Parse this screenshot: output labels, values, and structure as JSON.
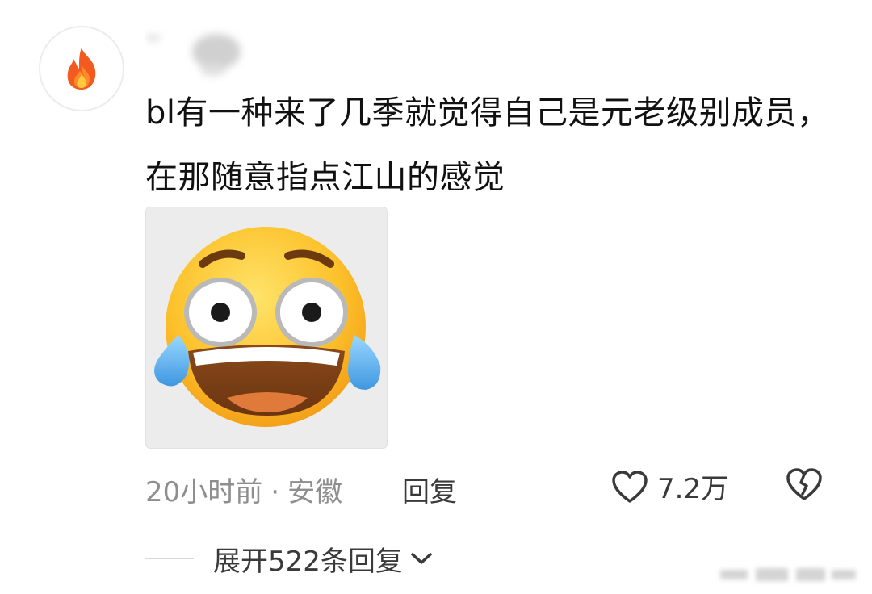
{
  "comment": {
    "avatar_icon": "fire-icon",
    "text": "bl有一种来了几季就觉得自己是元老级别成员，在那随意指点江山的感觉",
    "sticker_icon": "laughing-crying-emoji-icon"
  },
  "meta": {
    "time": "20小时前",
    "separator": "·",
    "location": "安徽",
    "reply_label": "回复",
    "like_icon": "heart-outline-icon",
    "like_count": "7.2万",
    "dislike_icon": "broken-heart-icon"
  },
  "expand": {
    "label": "展开522条回复",
    "icon": "chevron-down-icon"
  },
  "colors": {
    "meta_gray": "#8e8e8e",
    "action_dark": "#3a3a3a",
    "text": "#111111",
    "fire_orange": "#f25a1f",
    "fire_yellow": "#ffc83d",
    "emoji_yellow": "#f7b928",
    "tear_blue": "#5bb6f0"
  }
}
